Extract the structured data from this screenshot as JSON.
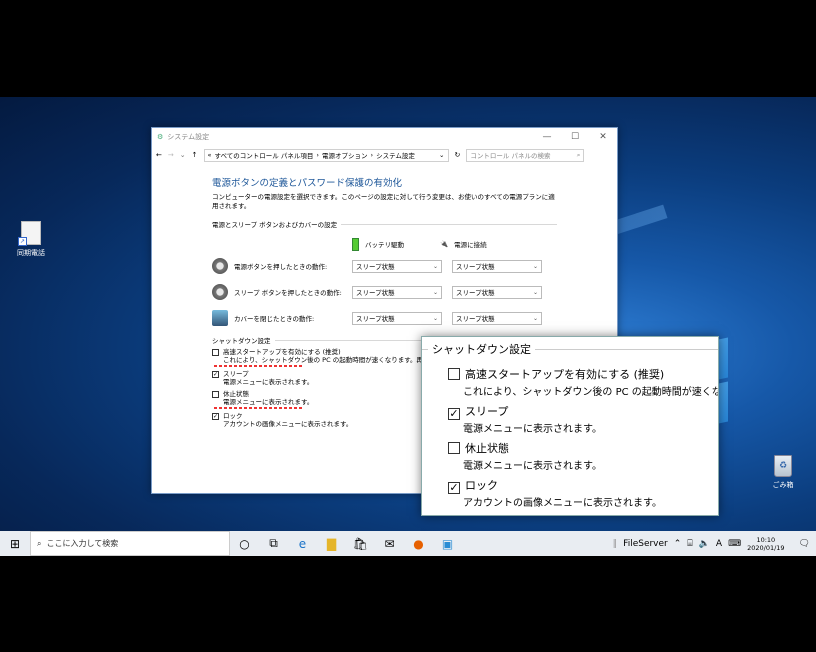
{
  "window": {
    "title": "システム設定",
    "controls": [
      "—",
      "☐",
      "✕"
    ],
    "address_prefix": "«",
    "breadcrumb": [
      "すべてのコントロール パネル項目",
      "電源オプション",
      "システム設定"
    ],
    "search_placeholder": "コントロール パネルの検索"
  },
  "page": {
    "heading": "電源ボタンの定義とパスワード保護の有効化",
    "description": "コンピューターの電源設定を選択できます。このページの設定に対して行う変更は、お使いのすべての電源プランに適用されます。",
    "section_buttons": "電源とスリープ ボタンおよびカバーの設定",
    "col_battery": "バッテリ駆動",
    "col_plugged": "電源に接続",
    "rows": [
      {
        "label": "電源ボタンを押したときの動作:",
        "battery": "スリープ状態",
        "plugged": "スリープ状態"
      },
      {
        "label": "スリープ ボタンを押したときの動作:",
        "battery": "スリープ状態",
        "plugged": "スリープ状態"
      },
      {
        "label": "カバーを閉じたときの動作:",
        "battery": "スリープ状態",
        "plugged": "スリープ状態"
      }
    ],
    "section_shutdown": "シャットダウン設定",
    "shutdown_items": [
      {
        "label": "高速スタートアップを有効にする (推奨)",
        "checked": false,
        "sub": "これにより、シャットダウン後の PC の起動時間が速くなります。再起"
      },
      {
        "label": "スリープ",
        "checked": true,
        "sub": "電源メニューに表示されます。"
      },
      {
        "label": "休止状態",
        "checked": false,
        "sub": "電源メニューに表示されます。"
      },
      {
        "label": "ロック",
        "checked": true,
        "sub": "アカウントの画像メニューに表示されます。"
      }
    ]
  },
  "zoom": {
    "title": "シャットダウン設定",
    "items": [
      {
        "label": "高速スタートアップを有効にする (推奨)",
        "checked": false,
        "sub": "これにより、シャットダウン後の PC の起動時間が速くなり"
      },
      {
        "label": "スリープ",
        "checked": true,
        "sub": "電源メニューに表示されます。"
      },
      {
        "label": "休止状態",
        "checked": false,
        "sub": "電源メニューに表示されます。"
      },
      {
        "label": "ロック",
        "checked": true,
        "sub": "アカウントの画像メニューに表示されます。"
      }
    ]
  },
  "desktop": {
    "icon1": "同期電話",
    "icon2": "ごみ箱"
  },
  "taskbar": {
    "search_placeholder": "ここに入力して検索",
    "fileserver": "FileServer",
    "time": "10:10",
    "date": "2020/01/19",
    "ime": "A"
  }
}
